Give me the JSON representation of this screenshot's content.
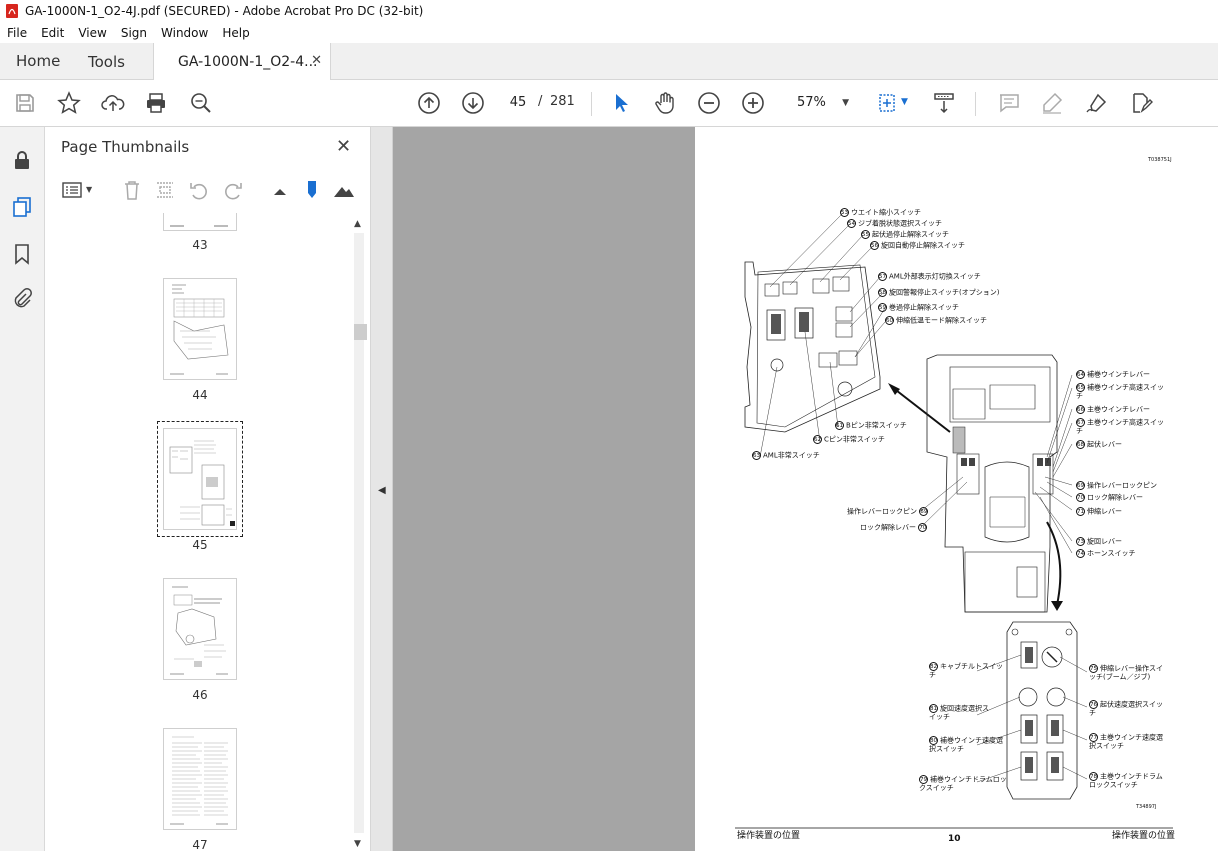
{
  "window": {
    "title": "GA-1000N-1_O2-4J.pdf (SECURED) - Adobe Acrobat Pro DC (32-bit)"
  },
  "menu": [
    "File",
    "Edit",
    "View",
    "Sign",
    "Window",
    "Help"
  ],
  "tabs": {
    "home": "Home",
    "tools": "Tools",
    "document": "GA-1000N-1_O2-4..."
  },
  "toolbar": {
    "current_page": "45",
    "separator": "/",
    "total_pages": "281",
    "zoom": "57%"
  },
  "panel": {
    "title": "Page Thumbnails",
    "thumbnails": [
      {
        "label": "43"
      },
      {
        "label": "44"
      },
      {
        "label": "45",
        "selected": true
      },
      {
        "label": "46"
      },
      {
        "label": "47"
      }
    ]
  },
  "page": {
    "code_top": "T038751J",
    "code_bottom": "T34897J",
    "footer_left": "操作装置の位置",
    "footer_number": "10",
    "footer_right": "操作装置の位置",
    "labels": [
      {
        "n": "53",
        "text": "ウエイト縮小スイッチ"
      },
      {
        "n": "54",
        "text": "ジブ着脱状態選択スイッチ"
      },
      {
        "n": "55",
        "text": "起伏過停止解除スイッチ"
      },
      {
        "n": "56",
        "text": "旋回自動停止解除スイッチ"
      },
      {
        "n": "57",
        "text": "AML外部表示灯切換スイッチ"
      },
      {
        "n": "58",
        "text": "旋回警報停止スイッチ(オプション)"
      },
      {
        "n": "59",
        "text": "巻過停止解除スイッチ"
      },
      {
        "n": "60",
        "text": "伸縮低温モード解除スイッチ"
      },
      {
        "n": "61",
        "text": "Bピン非常スイッチ"
      },
      {
        "n": "62",
        "text": "Cピン非常スイッチ"
      },
      {
        "n": "63",
        "text": "AML非常スイッチ"
      },
      {
        "n": "64",
        "text": "補巻ウインチレバー"
      },
      {
        "n": "65",
        "text": "補巻ウインチ高速スイッチ"
      },
      {
        "n": "66",
        "text": "主巻ウインチレバー"
      },
      {
        "n": "67",
        "text": "主巻ウインチ高速スイッチ"
      },
      {
        "n": "68",
        "text": "起伏レバー"
      },
      {
        "n": "69",
        "text": "操作レバーロックピン"
      },
      {
        "n": "70",
        "text": "ロック解除レバー"
      },
      {
        "n": "71",
        "text": "伸縮レバー"
      },
      {
        "n": "73",
        "text": "旋回レバー"
      },
      {
        "n": "74",
        "text": "ホーンスイッチ"
      },
      {
        "n": "69b",
        "text": "操作レバーロックピン"
      },
      {
        "n": "70b",
        "text": "ロック解除レバー"
      },
      {
        "n": "82",
        "text": "キャブチルトスイッチ"
      },
      {
        "n": "75",
        "text": "伸縮レバー操作スイッチ(ブーム／ジブ)"
      },
      {
        "n": "81",
        "text": "旋回速度選択スイッチ"
      },
      {
        "n": "76",
        "text": "起伏速度選択スイッチ"
      },
      {
        "n": "80",
        "text": "補巻ウインチ速度選択スイッチ"
      },
      {
        "n": "77",
        "text": "主巻ウインチ速度選択スイッチ"
      },
      {
        "n": "79",
        "text": "補巻ウインチドラムロックスイッチ"
      },
      {
        "n": "78",
        "text": "主巻ウインチドラムロックスイッチ"
      }
    ]
  }
}
